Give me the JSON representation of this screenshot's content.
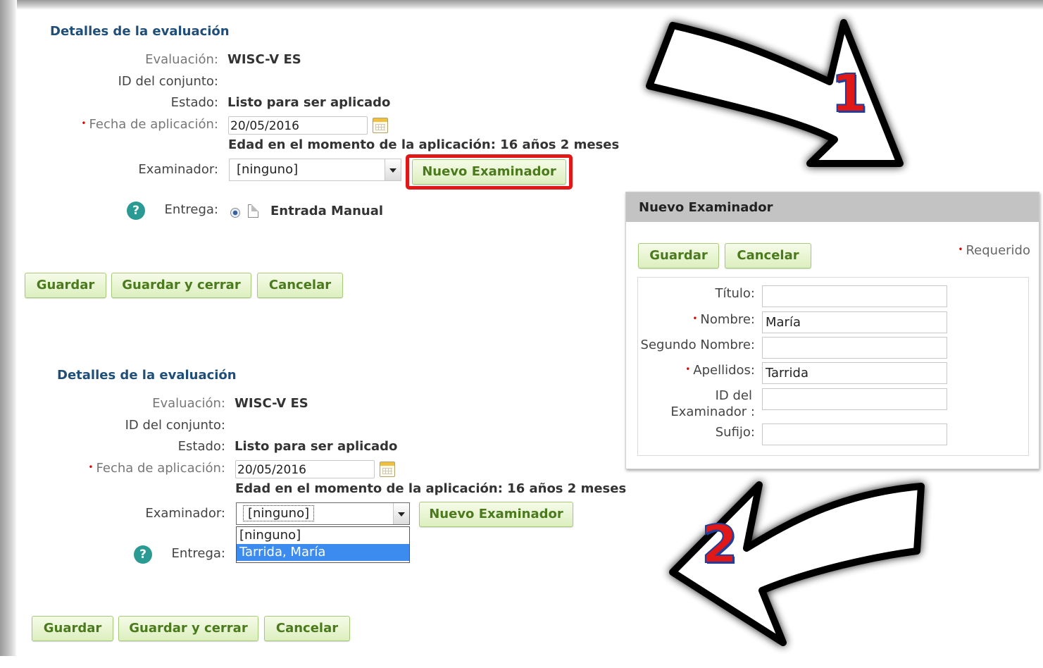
{
  "panel1": {
    "title": "Detalles de la evaluación",
    "labels": {
      "evaluacion": "Evaluación:",
      "id_conjunto": "ID del conjunto:",
      "estado": "Estado:",
      "fecha": "Fecha de aplicación:",
      "examinador": "Examinador:",
      "entrega": "Entrega:"
    },
    "values": {
      "evaluacion": "WISC-V ES",
      "estado": "Listo para ser aplicado",
      "fecha": "20/05/2016",
      "edad": "Edad en el momento de la aplicación:  16 años 2 meses",
      "examinador": "[ninguno]",
      "entrega": "Entrada Manual"
    },
    "nuevo_examinador_button": "Nuevo Examinador",
    "buttons": {
      "guardar": "Guardar",
      "guardar_cerrar": "Guardar y cerrar",
      "cancelar": "Cancelar"
    }
  },
  "panel2": {
    "title": "Detalles de la evaluación",
    "labels": {
      "evaluacion": "Evaluación:",
      "id_conjunto": "ID del conjunto:",
      "estado": "Estado:",
      "fecha": "Fecha de aplicación:",
      "examinador": "Examinador:",
      "entrega": "Entrega:"
    },
    "values": {
      "evaluacion": "WISC-V ES",
      "estado": "Listo para ser aplicado",
      "fecha": "20/05/2016",
      "edad": "Edad en el momento de la aplicación:  16 años 2 meses",
      "examinador": "[ninguno]"
    },
    "dropdown_options": [
      "[ninguno]",
      "Tarrida, María"
    ],
    "dropdown_selected_index": 1,
    "nuevo_examinador_button": "Nuevo Examinador",
    "buttons": {
      "guardar": "Guardar",
      "guardar_cerrar": "Guardar y cerrar",
      "cancelar": "Cancelar"
    }
  },
  "dialog": {
    "title": "Nuevo Examinador",
    "buttons": {
      "guardar": "Guardar",
      "cancelar": "Cancelar"
    },
    "required_note": "Requerido",
    "fields": {
      "titulo": {
        "label": "Título:",
        "value": ""
      },
      "nombre": {
        "label": "Nombre:",
        "value": "María"
      },
      "segundo_nombre": {
        "label": "Segundo Nombre:",
        "value": ""
      },
      "apellidos": {
        "label": "Apellidos:",
        "value": "Tarrida"
      },
      "id_examinador": {
        "label_line1": "ID del",
        "label_line2": "Examinador :",
        "value": ""
      },
      "sufijo": {
        "label": "Sufijo:",
        "value": ""
      }
    }
  },
  "steps": {
    "step1": "1",
    "step2": "2"
  },
  "colors": {
    "title_blue": "#1f4e79",
    "button_green_text": "#4a7a1c",
    "highlight_red": "#e01818",
    "help_teal": "#2b9a92",
    "dropdown_selected": "#3c8cf0"
  },
  "icons": [
    "calendar-icon",
    "select-arrow-icon",
    "help-icon",
    "radio-icon",
    "document-icon",
    "curved-arrow-icon"
  ]
}
